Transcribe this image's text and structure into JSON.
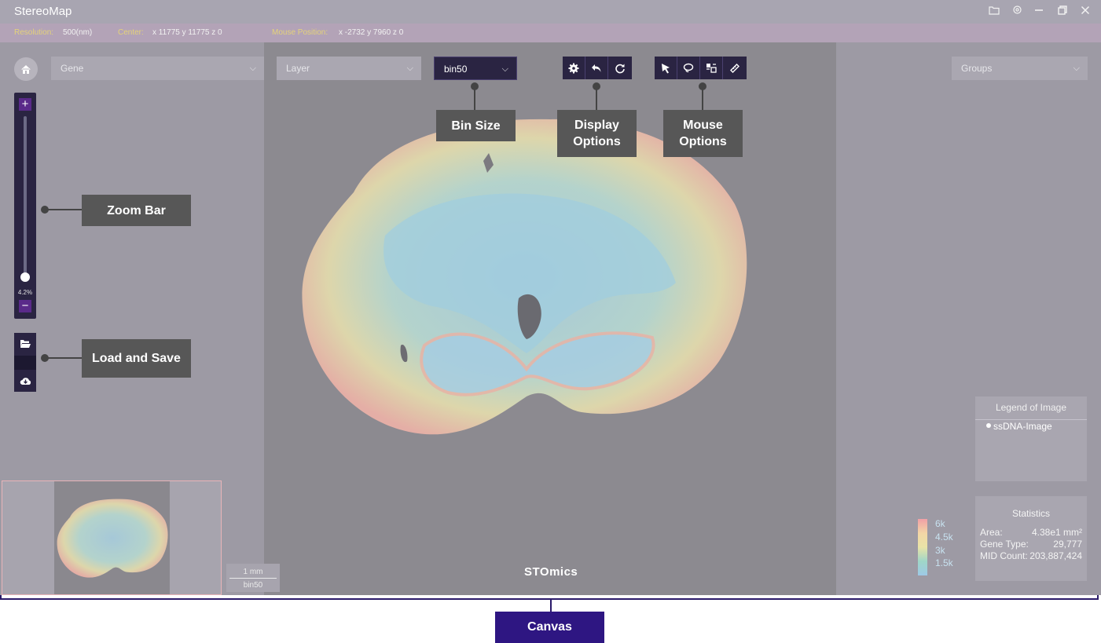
{
  "app": {
    "title": "StereoMap"
  },
  "window_controls": [
    "folder-icon",
    "settings-icon",
    "minimize-icon",
    "restore-icon",
    "close-icon"
  ],
  "status": {
    "resolution_label": "Resolution:",
    "resolution_value": "500(nm)",
    "center_label": "Center:",
    "center_value": "x 11775   y 11775   z 0",
    "mouse_label": "Mouse Position:",
    "mouse_value": "x -2732  y 7960  z 0"
  },
  "controls": {
    "gene_dropdown": "Gene",
    "layer_dropdown": "Layer",
    "bin_dropdown": "bin50",
    "groups_dropdown": "Groups"
  },
  "zoom": {
    "percent_label": "4.2%",
    "plus": "+",
    "minus": "−"
  },
  "display_tools": [
    "gear-icon",
    "undo-icon",
    "redo-icon"
  ],
  "mouse_tools": [
    "pointer-icon",
    "lasso-icon",
    "rect-select-icon",
    "ruler-icon"
  ],
  "callouts": {
    "bin_size": "Bin Size",
    "display_options": "Display Options",
    "mouse_options": "Mouse Options",
    "zoom_bar": "Zoom Bar",
    "load_save": "Load and Save",
    "canvas": "Canvas"
  },
  "scale_bar": {
    "length": "1 mm",
    "bin": "bin50"
  },
  "brand": "STOmics",
  "legend": {
    "title": "Legend of Image",
    "items": [
      "ssDNA-Image"
    ]
  },
  "color_scale": {
    "labels": [
      "6k",
      "4.5k",
      "3k",
      "1.5k"
    ]
  },
  "statistics": {
    "title": "Statistics",
    "area_label": "Area:",
    "area_value": "4.38e1 mm²",
    "gene_type_label": "Gene Type:",
    "gene_type_value": "29,777",
    "mid_label": "MID Count:",
    "mid_value": "203,887,424"
  },
  "colors": {
    "accent": "#2a2442",
    "callout": "#575757",
    "canvas_label": "#2e1682"
  }
}
